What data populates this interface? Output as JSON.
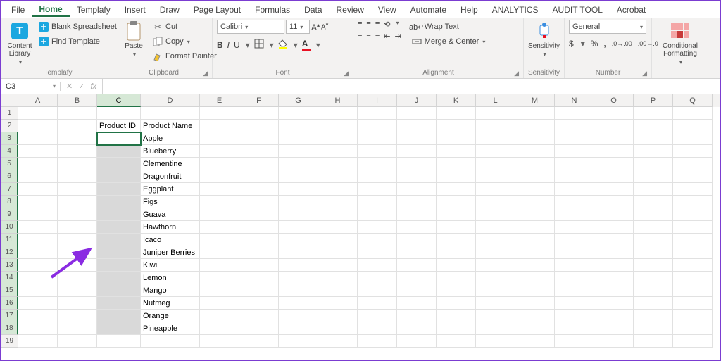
{
  "menu": {
    "tabs": [
      "File",
      "Home",
      "Templafy",
      "Insert",
      "Draw",
      "Page Layout",
      "Formulas",
      "Data",
      "Review",
      "View",
      "Automate",
      "Help",
      "ANALYTICS",
      "AUDIT TOOL",
      "Acrobat"
    ],
    "active": 1
  },
  "ribbon": {
    "templafy": {
      "content_library": "Content\nLibrary",
      "blank": "Blank Spreadsheet",
      "find": "Find Template",
      "label": "Templafy"
    },
    "clipboard": {
      "paste": "Paste",
      "cut": "Cut",
      "copy": "Copy",
      "format_painter": "Format Painter",
      "label": "Clipboard"
    },
    "font": {
      "name": "Calibri",
      "size": "11",
      "label": "Font",
      "bold": "B",
      "italic": "I",
      "underline": "U"
    },
    "alignment": {
      "wrap": "Wrap Text",
      "merge": "Merge & Center",
      "label": "Alignment"
    },
    "sensitivity": {
      "btn": "Sensitivity",
      "label": "Sensitivity"
    },
    "number": {
      "format": "General",
      "label": "Number"
    },
    "conditional": {
      "btn": "Conditional\nFormatting",
      "label": ""
    }
  },
  "formula_bar": {
    "name_box": "C3",
    "fx": "fx"
  },
  "grid": {
    "cols": [
      "A",
      "B",
      "C",
      "D",
      "E",
      "F",
      "G",
      "H",
      "I",
      "J",
      "K",
      "L",
      "M",
      "N",
      "O",
      "P",
      "Q"
    ],
    "selected_col_index": 2,
    "rows": 19,
    "selected_rows_start": 3,
    "selected_rows_end": 18,
    "headers": {
      "c": "Product ID",
      "d": "Product Name"
    },
    "products": [
      "Apple",
      "Blueberry",
      "Clementine",
      "Dragonfruit",
      "Eggplant",
      "Figs",
      "Guava",
      "Hawthorn",
      "Icaco",
      "Juniper Berries",
      "Kiwi",
      "Lemon",
      "Mango",
      "Nutmeg",
      "Orange",
      "Pineapple"
    ]
  }
}
